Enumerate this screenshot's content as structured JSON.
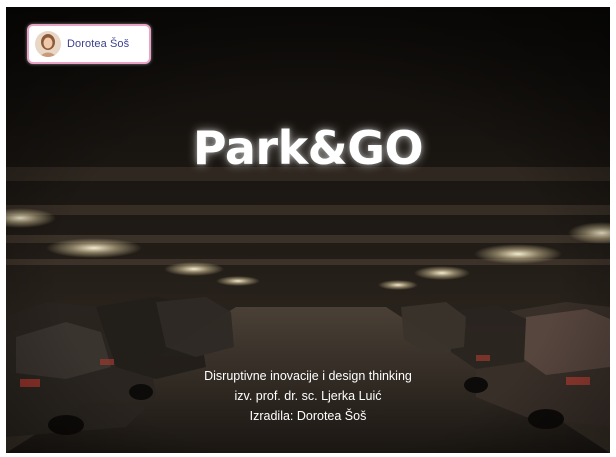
{
  "presenter": {
    "name": "Dorotea Šoš"
  },
  "slide": {
    "title": "Park&GO",
    "subtitle_lines": [
      "Disruptivne inovacije i design thinking",
      "izv. prof. dr. sc. Ljerka Luić",
      "Izradila: Dorotea Šoš"
    ]
  },
  "colors": {
    "badge_border": "#e8a3c6",
    "badge_text": "#3a3f8f",
    "title_text": "#ffffff"
  }
}
